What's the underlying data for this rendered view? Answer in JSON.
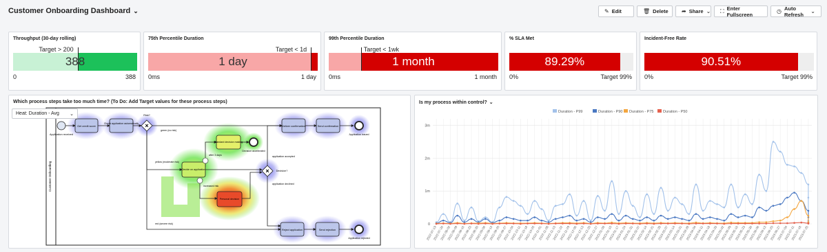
{
  "header": {
    "title": "Customer Onboarding Dashboard",
    "caret": "⌄",
    "buttons": {
      "edit": "Edit",
      "delete": "Delete",
      "share": "Share",
      "fullscreen": "Enter Fullscreen",
      "auto_refresh": "Auto Refresh"
    }
  },
  "kpis": [
    {
      "title": "Throughput (30-day rolling)",
      "target": "Target > 200",
      "value": "388",
      "min": "0",
      "max": "388",
      "fill_fraction": 1.0,
      "marker_fraction": 0.52,
      "color": "#1cc15a",
      "light_color": "#c8f1d5"
    },
    {
      "title": "75th Percentile Duration",
      "target": "Target < 1d",
      "value": "1 day",
      "min": "0ms",
      "max": "1 day",
      "fill_fraction": 1.0,
      "marker_fraction": 0.96,
      "color": "#d40000",
      "light_color": "#f8a7a7"
    },
    {
      "title": "99th Percentile Duration",
      "target": "Target < 1wk",
      "value": "1 month",
      "min": "0ms",
      "max": "1 month",
      "fill_fraction": 1.0,
      "marker_fraction": 0.19,
      "color": "#d40000",
      "light_color": "#f8a7a7"
    },
    {
      "title": "% SLA Met",
      "target": "",
      "value": "89.29%",
      "min": "0%",
      "max": "Target 99%",
      "fill_fraction": 0.8929,
      "marker_fraction": null,
      "color": "#d40000",
      "light_color": "#eeeeee"
    },
    {
      "title": "Incident-Free Rate",
      "target": "",
      "value": "90.51%",
      "min": "0%",
      "max": "Target 99%",
      "fill_fraction": 0.9051,
      "marker_fraction": null,
      "color": "#d40000",
      "light_color": "#eeeeee"
    }
  ],
  "process_panel": {
    "title": "Which process steps take too much time? (To Do: Add Target values for these process steps)",
    "heat_select": "Heat: Duration - Avg",
    "lane_label": "Customer Onboarding",
    "nodes": {
      "start": "Application received",
      "get_credit": "Get credit score",
      "check_app": "Check application automatically",
      "risk": "Risk?",
      "green": "green (no risk)",
      "yellow": "yellow (moderate risk)",
      "red": "red (severe risk)",
      "deliver": "Deliver confirmation",
      "send_conf": "Send confirmation",
      "issued": "Application issued",
      "standard": "Standard decision making",
      "after3": "after 3 days",
      "decision_acc": "Decision accelerated",
      "decide": "Decide on application",
      "decision": "Decision?",
      "app_accepted": "application accepted",
      "app_declined": "application declined",
      "increased": "increased risk",
      "personal": "Personal decision",
      "reject": "Reject application",
      "send_rej": "Send rejection",
      "rejected": "Application rejected"
    }
  },
  "control_panel": {
    "title": "Is my process within control?",
    "caret": "⌄"
  },
  "chart_data": {
    "type": "line",
    "title": "",
    "ylabel": "",
    "y_tick_labels": [
      "0",
      "1m",
      "2m",
      "3m"
    ],
    "ylim": [
      0,
      3.2
    ],
    "unit": "month",
    "legend_position": "top",
    "legend": [
      "Duration - P99",
      "Duration - P90",
      "Duration - P75",
      "Duration - P50"
    ],
    "x": [
      "2022-07-19",
      "2022-07-26",
      "2022-08-02",
      "2022-08-09",
      "2022-08-16",
      "2022-08-23",
      "2022-08-30",
      "2022-09-06",
      "2022-09-13",
      "2022-09-20",
      "2022-09-27",
      "2022-10-04",
      "2022-10-11",
      "2022-10-18",
      "2022-10-25",
      "2022-11-01",
      "2022-11-08",
      "2022-11-15",
      "2022-11-22",
      "2022-11-29",
      "2022-12-06",
      "2022-12-13",
      "2022-12-20",
      "2022-12-27",
      "2023-01-03",
      "2023-01-10",
      "2023-01-17",
      "2023-01-24",
      "2023-01-31",
      "2023-02-07",
      "2023-02-14",
      "2023-02-21",
      "2023-02-28",
      "2023-03-07",
      "2023-03-14",
      "2023-03-21",
      "2023-03-28",
      "2023-04-04",
      "2023-04-11",
      "2023-04-18",
      "2023-04-25",
      "2023-05-02",
      "2023-05-09",
      "2023-05-16",
      "2023-05-23",
      "2023-05-30",
      "2023-06-06",
      "2023-06-13",
      "2023-06-20",
      "2023-06-27",
      "2023-07-04",
      "2023-07-11",
      "2023-07-18",
      "2023-07-25"
    ],
    "series": [
      {
        "name": "Duration - P99",
        "color": "#a3c2ea",
        "values": [
          0.05,
          0.3,
          0.05,
          0.62,
          0.1,
          0.5,
          0.08,
          0.2,
          0.05,
          0.5,
          0.82,
          0.7,
          0.55,
          0.3,
          0.7,
          0.45,
          0.1,
          0.55,
          0.6,
          0.9,
          0.25,
          0.7,
          0.1,
          0.85,
          0.4,
          1.3,
          0.3,
          1.0,
          0.55,
          0.2,
          0.9,
          0.3,
          1.1,
          0.4,
          0.8,
          0.6,
          0.3,
          1.2,
          0.4,
          0.7,
          0.6,
          0.5,
          1.2,
          0.5,
          0.9,
          0.6,
          1.5,
          1.0,
          2.5,
          2.2,
          1.8,
          1.75,
          1.55,
          1.2,
          0.8,
          0.1
        ]
      },
      {
        "name": "Duration - P90",
        "color": "#4a78c2",
        "values": [
          0.02,
          0.1,
          0.03,
          0.25,
          0.05,
          0.15,
          0.05,
          0.15,
          0.03,
          0.1,
          0.2,
          0.15,
          0.1,
          0.1,
          0.2,
          0.1,
          0.05,
          0.15,
          0.2,
          0.25,
          0.1,
          0.15,
          0.05,
          0.2,
          0.15,
          0.3,
          0.1,
          0.25,
          0.15,
          0.1,
          0.2,
          0.1,
          0.25,
          0.15,
          0.2,
          0.15,
          0.1,
          0.3,
          0.15,
          0.2,
          0.15,
          0.1,
          0.3,
          0.2,
          0.25,
          0.2,
          0.5,
          0.4,
          0.55,
          0.6,
          0.8,
          0.95,
          0.7,
          0.4,
          0.2,
          0.05
        ]
      },
      {
        "name": "Duration - P75",
        "color": "#f3a640",
        "values": [
          0.01,
          0.02,
          0.01,
          0.03,
          0.01,
          0.02,
          0.02,
          0.03,
          0.01,
          0.02,
          0.03,
          0.02,
          0.02,
          0.02,
          0.03,
          0.02,
          0.01,
          0.02,
          0.03,
          0.03,
          0.02,
          0.03,
          0.01,
          0.03,
          0.02,
          0.04,
          0.02,
          0.03,
          0.02,
          0.02,
          0.03,
          0.02,
          0.03,
          0.02,
          0.03,
          0.02,
          0.02,
          0.04,
          0.02,
          0.03,
          0.02,
          0.02,
          0.04,
          0.03,
          0.03,
          0.03,
          0.05,
          0.05,
          0.08,
          0.1,
          0.2,
          0.45,
          0.7,
          0.25,
          0.05,
          0.02
        ]
      },
      {
        "name": "Duration - P50",
        "color": "#e5614e",
        "values": [
          0.0,
          0.01,
          0.0,
          0.01,
          0.0,
          0.01,
          0.0,
          0.01,
          0.0,
          0.01,
          0.01,
          0.01,
          0.0,
          0.01,
          0.01,
          0.01,
          0.0,
          0.01,
          0.01,
          0.01,
          0.0,
          0.01,
          0.0,
          0.01,
          0.01,
          0.01,
          0.0,
          0.01,
          0.01,
          0.0,
          0.01,
          0.0,
          0.01,
          0.01,
          0.01,
          0.01,
          0.0,
          0.01,
          0.01,
          0.01,
          0.01,
          0.0,
          0.01,
          0.01,
          0.01,
          0.01,
          0.01,
          0.01,
          0.02,
          0.02,
          0.02,
          0.03,
          0.04,
          0.02,
          0.01,
          0.01
        ]
      }
    ]
  }
}
